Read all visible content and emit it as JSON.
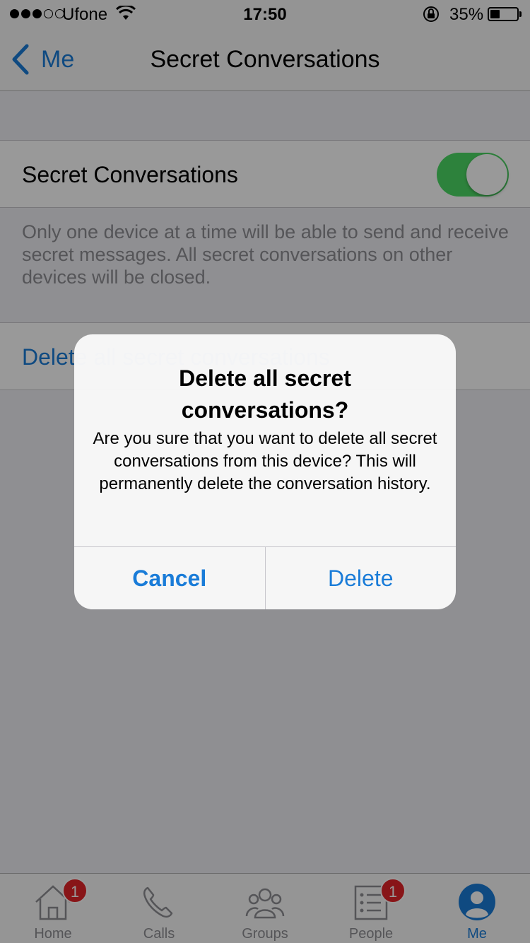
{
  "status_bar": {
    "carrier": "Ufone",
    "time": "17:50",
    "battery_percent": "35%",
    "icons": [
      "signal-dots-icon",
      "wifi-icon",
      "rotation-lock-icon",
      "battery-icon"
    ]
  },
  "nav": {
    "back_label": "Me",
    "title": "Secret Conversations"
  },
  "settings": {
    "toggle_label": "Secret Conversations",
    "toggle_on": true,
    "footer": "Only one device at a time will be able to send and receive secret messages. All secret conversations on other devices will be closed.",
    "delete_label": "Delete all secret conversations"
  },
  "alert": {
    "title": "Delete all secret conversations?",
    "message": "Are you sure that you want to delete all secret conversations from this device? This will permanently delete the conversation history.",
    "cancel_label": "Cancel",
    "delete_label": "Delete"
  },
  "tabs": [
    {
      "label": "Home",
      "icon": "home-icon",
      "badge": "1"
    },
    {
      "label": "Calls",
      "icon": "phone-icon",
      "badge": ""
    },
    {
      "label": "Groups",
      "icon": "groups-icon",
      "badge": ""
    },
    {
      "label": "People",
      "icon": "people-list-icon",
      "badge": "1"
    },
    {
      "label": "Me",
      "icon": "profile-icon",
      "badge": ""
    }
  ],
  "colors": {
    "accent": "#1a7cd8",
    "toggle_on": "#4cd964",
    "badge": "#e32428"
  }
}
